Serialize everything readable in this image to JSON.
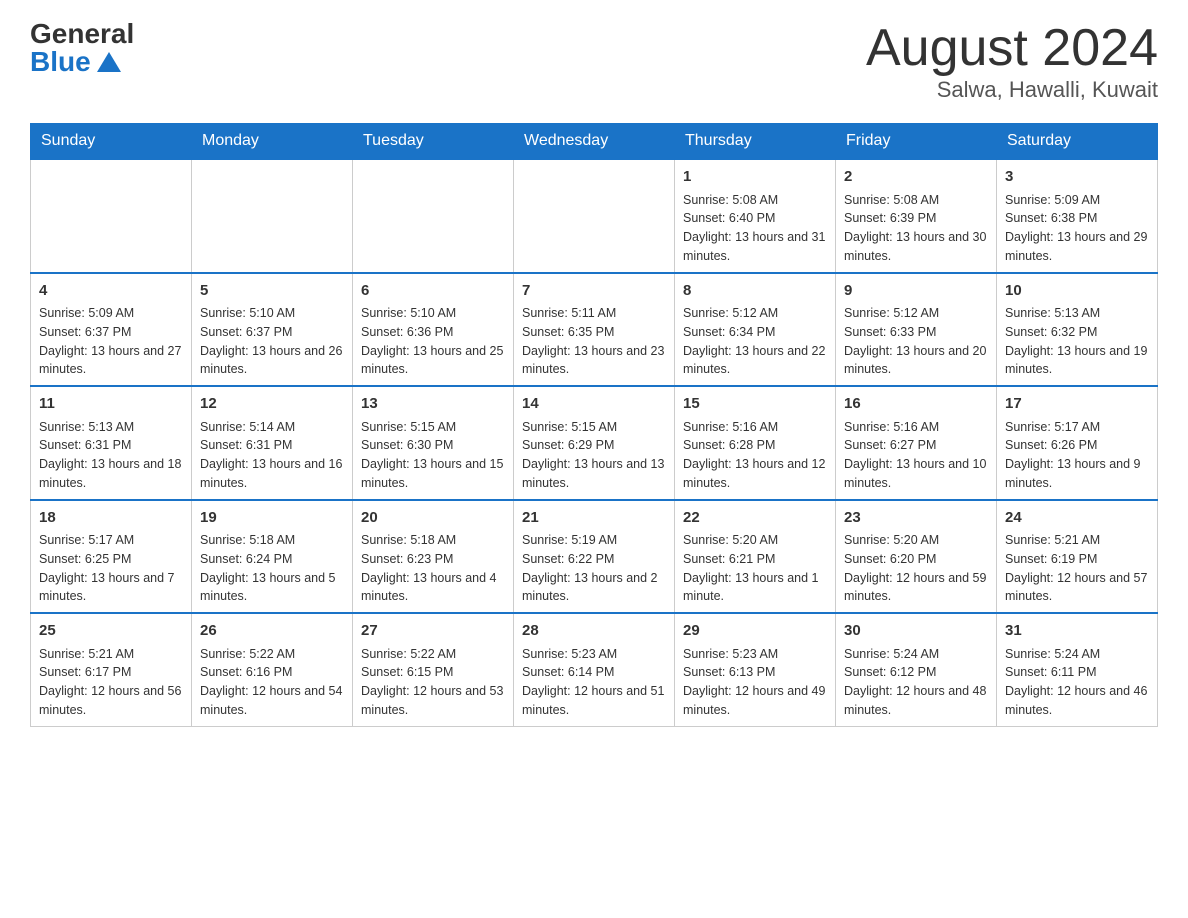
{
  "logo": {
    "general": "General",
    "blue": "Blue"
  },
  "title": "August 2024",
  "subtitle": "Salwa, Hawalli, Kuwait",
  "days_of_week": [
    "Sunday",
    "Monday",
    "Tuesday",
    "Wednesday",
    "Thursday",
    "Friday",
    "Saturday"
  ],
  "weeks": [
    [
      {
        "day": "",
        "info": ""
      },
      {
        "day": "",
        "info": ""
      },
      {
        "day": "",
        "info": ""
      },
      {
        "day": "",
        "info": ""
      },
      {
        "day": "1",
        "info": "Sunrise: 5:08 AM\nSunset: 6:40 PM\nDaylight: 13 hours and 31 minutes."
      },
      {
        "day": "2",
        "info": "Sunrise: 5:08 AM\nSunset: 6:39 PM\nDaylight: 13 hours and 30 minutes."
      },
      {
        "day": "3",
        "info": "Sunrise: 5:09 AM\nSunset: 6:38 PM\nDaylight: 13 hours and 29 minutes."
      }
    ],
    [
      {
        "day": "4",
        "info": "Sunrise: 5:09 AM\nSunset: 6:37 PM\nDaylight: 13 hours and 27 minutes."
      },
      {
        "day": "5",
        "info": "Sunrise: 5:10 AM\nSunset: 6:37 PM\nDaylight: 13 hours and 26 minutes."
      },
      {
        "day": "6",
        "info": "Sunrise: 5:10 AM\nSunset: 6:36 PM\nDaylight: 13 hours and 25 minutes."
      },
      {
        "day": "7",
        "info": "Sunrise: 5:11 AM\nSunset: 6:35 PM\nDaylight: 13 hours and 23 minutes."
      },
      {
        "day": "8",
        "info": "Sunrise: 5:12 AM\nSunset: 6:34 PM\nDaylight: 13 hours and 22 minutes."
      },
      {
        "day": "9",
        "info": "Sunrise: 5:12 AM\nSunset: 6:33 PM\nDaylight: 13 hours and 20 minutes."
      },
      {
        "day": "10",
        "info": "Sunrise: 5:13 AM\nSunset: 6:32 PM\nDaylight: 13 hours and 19 minutes."
      }
    ],
    [
      {
        "day": "11",
        "info": "Sunrise: 5:13 AM\nSunset: 6:31 PM\nDaylight: 13 hours and 18 minutes."
      },
      {
        "day": "12",
        "info": "Sunrise: 5:14 AM\nSunset: 6:31 PM\nDaylight: 13 hours and 16 minutes."
      },
      {
        "day": "13",
        "info": "Sunrise: 5:15 AM\nSunset: 6:30 PM\nDaylight: 13 hours and 15 minutes."
      },
      {
        "day": "14",
        "info": "Sunrise: 5:15 AM\nSunset: 6:29 PM\nDaylight: 13 hours and 13 minutes."
      },
      {
        "day": "15",
        "info": "Sunrise: 5:16 AM\nSunset: 6:28 PM\nDaylight: 13 hours and 12 minutes."
      },
      {
        "day": "16",
        "info": "Sunrise: 5:16 AM\nSunset: 6:27 PM\nDaylight: 13 hours and 10 minutes."
      },
      {
        "day": "17",
        "info": "Sunrise: 5:17 AM\nSunset: 6:26 PM\nDaylight: 13 hours and 9 minutes."
      }
    ],
    [
      {
        "day": "18",
        "info": "Sunrise: 5:17 AM\nSunset: 6:25 PM\nDaylight: 13 hours and 7 minutes."
      },
      {
        "day": "19",
        "info": "Sunrise: 5:18 AM\nSunset: 6:24 PM\nDaylight: 13 hours and 5 minutes."
      },
      {
        "day": "20",
        "info": "Sunrise: 5:18 AM\nSunset: 6:23 PM\nDaylight: 13 hours and 4 minutes."
      },
      {
        "day": "21",
        "info": "Sunrise: 5:19 AM\nSunset: 6:22 PM\nDaylight: 13 hours and 2 minutes."
      },
      {
        "day": "22",
        "info": "Sunrise: 5:20 AM\nSunset: 6:21 PM\nDaylight: 13 hours and 1 minute."
      },
      {
        "day": "23",
        "info": "Sunrise: 5:20 AM\nSunset: 6:20 PM\nDaylight: 12 hours and 59 minutes."
      },
      {
        "day": "24",
        "info": "Sunrise: 5:21 AM\nSunset: 6:19 PM\nDaylight: 12 hours and 57 minutes."
      }
    ],
    [
      {
        "day": "25",
        "info": "Sunrise: 5:21 AM\nSunset: 6:17 PM\nDaylight: 12 hours and 56 minutes."
      },
      {
        "day": "26",
        "info": "Sunrise: 5:22 AM\nSunset: 6:16 PM\nDaylight: 12 hours and 54 minutes."
      },
      {
        "day": "27",
        "info": "Sunrise: 5:22 AM\nSunset: 6:15 PM\nDaylight: 12 hours and 53 minutes."
      },
      {
        "day": "28",
        "info": "Sunrise: 5:23 AM\nSunset: 6:14 PM\nDaylight: 12 hours and 51 minutes."
      },
      {
        "day": "29",
        "info": "Sunrise: 5:23 AM\nSunset: 6:13 PM\nDaylight: 12 hours and 49 minutes."
      },
      {
        "day": "30",
        "info": "Sunrise: 5:24 AM\nSunset: 6:12 PM\nDaylight: 12 hours and 48 minutes."
      },
      {
        "day": "31",
        "info": "Sunrise: 5:24 AM\nSunset: 6:11 PM\nDaylight: 12 hours and 46 minutes."
      }
    ]
  ]
}
